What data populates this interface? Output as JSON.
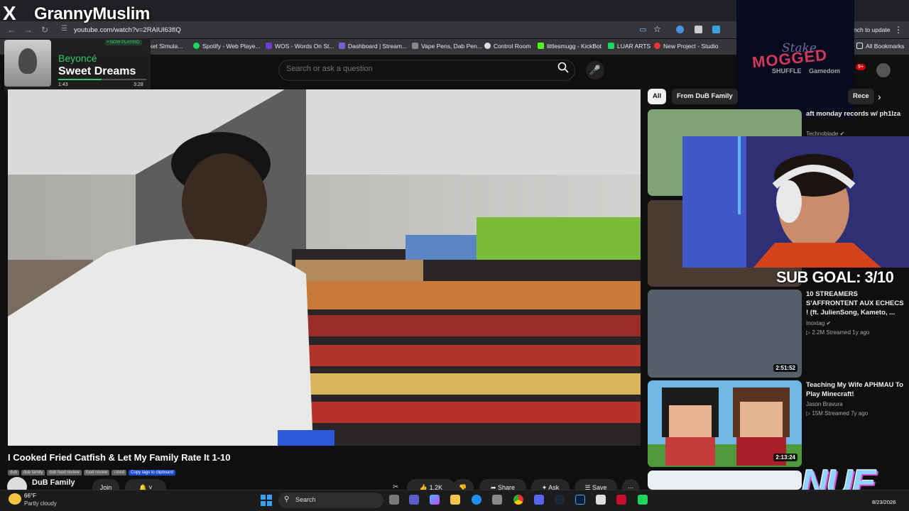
{
  "overlay": {
    "brand": "X",
    "streamer_name": "GrannyMuslim",
    "sub_goal": "SUB GOAL: 3/10",
    "logo_text": "NUE"
  },
  "now_playing": {
    "tag": "• NOW PLAYING",
    "artist": "Beyoncé",
    "song": "Sweet Dreams",
    "elapsed": "1:43",
    "duration": "3:28",
    "progress": 0.49
  },
  "sponsor": {
    "line1": "Stake",
    "line2": "MOGGED",
    "line3": "SHUFFLE",
    "line4": "Gamedom"
  },
  "browser": {
    "url": "youtube.com/watch?v=2RAIUl63fIQ",
    "update_label": "nch to update",
    "all_bookmarks": "All Bookmarks",
    "bookmarks": [
      {
        "label": "arket Simula...",
        "color": "#555"
      },
      {
        "label": "Spotify - Web Playe...",
        "color": "#1ed760"
      },
      {
        "label": "WOS - Words On St...",
        "color": "#6a3fd0"
      },
      {
        "label": "Dashboard | Stream...",
        "color": "#7b5cd6"
      },
      {
        "label": "Vape Pens, Dab Pen...",
        "color": "#888"
      },
      {
        "label": "Control Room",
        "color": "#ddd"
      },
      {
        "label": "littlesmugg - KickBot",
        "color": "#53fc18"
      },
      {
        "label": "LUAR ARTS",
        "color": "#1ed760"
      },
      {
        "label": "New Project - Studio",
        "color": "#e33"
      }
    ]
  },
  "youtube": {
    "search_placeholder": "Search or ask a question",
    "notif_count": "9+",
    "video_title": "I Cooked Fried Catfish & Let My Family Rate It 1-10",
    "tags": [
      "dub",
      "dub family",
      "dub food review",
      "food review",
      "i tried",
      "Copy tags to clipboard"
    ],
    "channel": "DuB Family",
    "join_label": "Join",
    "like_count": "1.2K",
    "share_label": "Share",
    "ask_label": "Ask",
    "save_label": "Save"
  },
  "chips": [
    {
      "label": "All"
    },
    {
      "label": "From DuB Family"
    },
    {
      "label": "Rece"
    }
  ],
  "recommendations": [
    {
      "title": "aft monday records w/ ph1lza",
      "channel": "Technoblade",
      "meta": ""
    },
    {
      "title": "10 STREAMERS S'AFFRONTENT AUX ECHECS ! (ft. JulienSong, Kameto, ...",
      "channel": "Inoxtag",
      "meta": "2.2M  Streamed 1y ago",
      "duration": "2:51:52"
    },
    {
      "title": "Teaching My Wife APHMAU To Play Minecraft!",
      "channel": "Jason Bravura",
      "meta": "15M  Streamed 7y ago",
      "duration": "2:13:24"
    }
  ],
  "taskbar": {
    "temp": "66°F",
    "condition": "Partly cloudy",
    "search_label": "Search",
    "date": "8/23/2026"
  }
}
